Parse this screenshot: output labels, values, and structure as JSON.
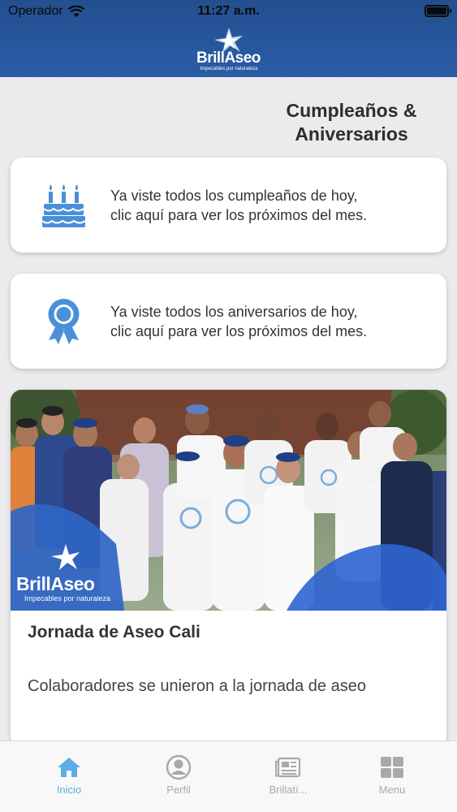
{
  "status_bar": {
    "carrier": "Operador",
    "time": "11:27 a.m."
  },
  "header": {
    "logo_brand": "BrillAseo",
    "logo_tagline": "Impecables por naturaleza"
  },
  "section_title": {
    "line1": "Cumpleaños &",
    "line2": "Aniversarios"
  },
  "birthdays_card": {
    "icon": "birthday-cake-icon",
    "line1": "Ya viste todos los cumpleaños de hoy,",
    "line2": "clic aquí para ver los próximos del mes."
  },
  "anniversaries_card": {
    "icon": "award-ribbon-icon",
    "line1": "Ya viste todos los aniversarios de hoy,",
    "line2": "clic aquí para ver los próximos del mes."
  },
  "news": {
    "photo_logo_brand": "BrillAseo",
    "photo_logo_tagline": "Impecables por naturaleza",
    "title": "Jornada de Aseo Cali",
    "description": "Colaboradores se unieron a la jornada de aseo"
  },
  "tabs": [
    {
      "label": "Inicio",
      "icon": "home-icon",
      "active": true
    },
    {
      "label": "Perfil",
      "icon": "profile-icon",
      "active": false
    },
    {
      "label": "Brillatí...",
      "icon": "newspaper-icon",
      "active": false
    },
    {
      "label": "Menu",
      "icon": "grid-icon",
      "active": false
    }
  ],
  "colors": {
    "header_blue": "#2b5ca6",
    "accent_blue": "#5aaee3",
    "background": "#ebebed"
  }
}
